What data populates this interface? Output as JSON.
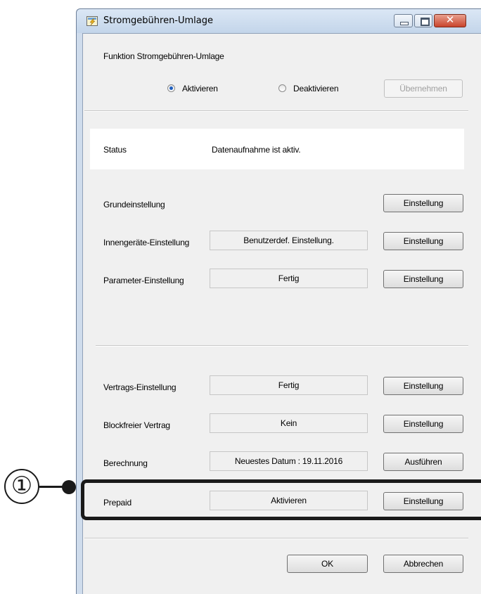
{
  "window": {
    "title": "Stromgebühren-Umlage",
    "close_glyph": "✕"
  },
  "function": {
    "label": "Funktion Stromgebühren-Umlage",
    "activate": "Aktivieren",
    "deactivate": "Deaktivieren",
    "selected": "Aktivieren",
    "apply": "Übernehmen"
  },
  "status": {
    "label": "Status",
    "value": "Datenaufnahme ist aktiv."
  },
  "settings": [
    {
      "label": "Grundeinstellung",
      "value": "",
      "button": "Einstellung"
    },
    {
      "label": "Innengeräte-Einstellung",
      "value": "Benutzerdef. Einstellung.",
      "button": "Einstellung"
    },
    {
      "label": "Parameter-Einstellung",
      "value": "Fertig",
      "button": "Einstellung"
    }
  ],
  "contracts": [
    {
      "label": "Vertrags-Einstellung",
      "value": "Fertig",
      "button": "Einstellung"
    },
    {
      "label": "Blockfreier Vertrag",
      "value": "Kein",
      "button": "Einstellung"
    },
    {
      "label": "Berechnung",
      "value": "Neuestes Datum : 19.11.2016",
      "button": "Ausführen"
    },
    {
      "label": "Prepaid",
      "value": "Aktivieren",
      "button": "Einstellung"
    }
  ],
  "footer": {
    "ok": "OK",
    "cancel": "Abbrechen"
  },
  "callout": {
    "number": "①"
  },
  "colors": {
    "radio_selected": "#1f5fbf",
    "close_button": "#c9442c",
    "callout": "#1a1a1a"
  }
}
